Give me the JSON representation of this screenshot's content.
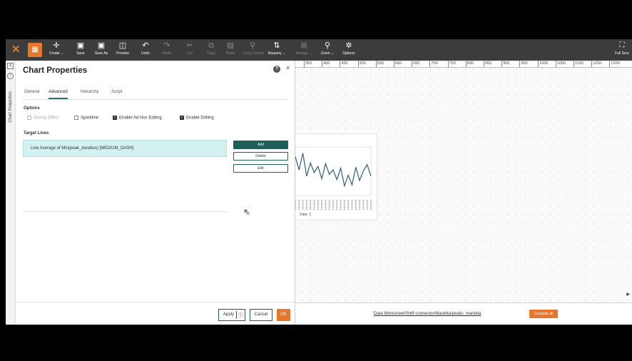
{
  "toolbar": {
    "buttons": [
      {
        "label": "Create ⌄",
        "icon": "✛"
      },
      {
        "label": "Save",
        "icon": "▣"
      },
      {
        "label": "Save As",
        "icon": "▣"
      },
      {
        "label": "Preview",
        "icon": "◫"
      },
      {
        "label": "Undo",
        "icon": "↶"
      },
      {
        "label": "Redo",
        "icon": "↷"
      },
      {
        "label": "Cut",
        "icon": "✂"
      },
      {
        "label": "Copy",
        "icon": "⧉"
      },
      {
        "label": "Paste",
        "icon": "▤"
      },
      {
        "label": "Copy Format",
        "icon": "⚲"
      },
      {
        "label": "Requery ⌄",
        "icon": "⇅"
      },
      {
        "label": "Arrange ⌄",
        "icon": "⊞"
      },
      {
        "label": "Zoom ⌄",
        "icon": "⚲"
      },
      {
        "label": "Options",
        "icon": "✲"
      }
    ],
    "fullscreen_label": "Full Scre"
  },
  "side": {
    "label": "Chart Properties"
  },
  "panel": {
    "title": "Chart Properties",
    "tabs": [
      "General",
      "Advanced",
      "Hierarchy",
      "Script"
    ],
    "options_heading": "Options",
    "options": [
      {
        "label": "Glossy Effect",
        "checked": false,
        "disabled": true
      },
      {
        "label": "Sparkline",
        "checked": false,
        "disabled": false
      },
      {
        "label": "Enable Ad Hoc Editing",
        "checked": true,
        "disabled": false
      },
      {
        "label": "Enable Drilling",
        "checked": true,
        "disabled": false
      }
    ],
    "target_lines_heading": "Target Lines",
    "target_lines": [
      "Line Average of Min(peak_duration) [MEDIUM_DASH]"
    ],
    "add_label": "Add",
    "delete_label": "Delete",
    "edit_label": "Edit",
    "apply_label": "Apply",
    "cancel_label": "Cancel",
    "ok_label": "OK"
  },
  "ruler": [
    "350",
    "400",
    "450",
    "500",
    "550",
    "600",
    "650",
    "700",
    "750",
    "800",
    "850",
    "900",
    "950",
    "1000",
    "1050",
    "1100",
    "1150",
    "1200"
  ],
  "chart_data": {
    "type": "line",
    "xlabel": "Date: 1",
    "series_color": "#2f5f7f",
    "values": [
      88,
      58,
      96,
      44,
      74,
      52,
      66,
      38,
      72,
      48,
      58,
      36,
      62,
      22,
      46,
      24,
      64,
      34,
      56,
      70,
      44
    ],
    "ylim": [
      0,
      110
    ]
  },
  "status": {
    "path": "Data Worksheet/Shift connector/Marietta/peaks_marietta",
    "console_label": "Console"
  }
}
